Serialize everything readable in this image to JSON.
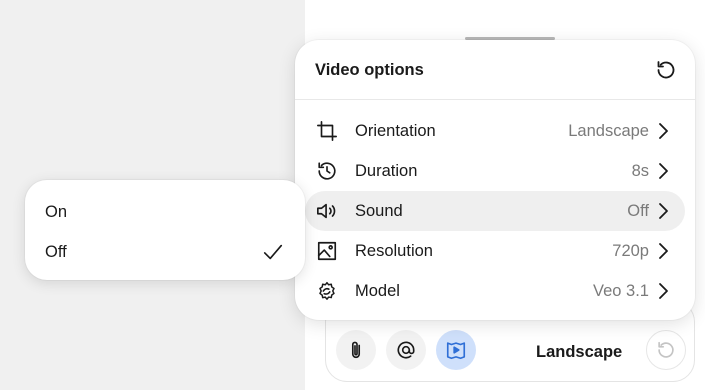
{
  "panel": {
    "title": "Video options",
    "reset_icon": "reset-icon",
    "options": [
      {
        "label": "Orientation",
        "value": "Landscape",
        "icon": "crop-icon"
      },
      {
        "label": "Duration",
        "value": "8s",
        "icon": "history-icon"
      },
      {
        "label": "Sound",
        "value": "Off",
        "icon": "speaker-icon",
        "highlighted": true
      },
      {
        "label": "Resolution",
        "value": "720p",
        "icon": "image-icon"
      },
      {
        "label": "Model",
        "value": "Veo 3.1",
        "icon": "model-icon"
      }
    ]
  },
  "submenu": {
    "items": [
      {
        "label": "On",
        "selected": false
      },
      {
        "label": "Off",
        "selected": true
      }
    ]
  },
  "composer": {
    "tools": [
      "paperclip-icon",
      "at-sign-icon",
      "video-icon"
    ],
    "active_tool": "video-icon",
    "preset_label": "Landscape"
  },
  "colors": {
    "active_tool_bg": "#cfe0fb",
    "active_tool_icon": "#2f6fd6",
    "highlight_row": "#efefef",
    "value_text": "#7a7a7a",
    "left_background": "#f0f0f0"
  }
}
